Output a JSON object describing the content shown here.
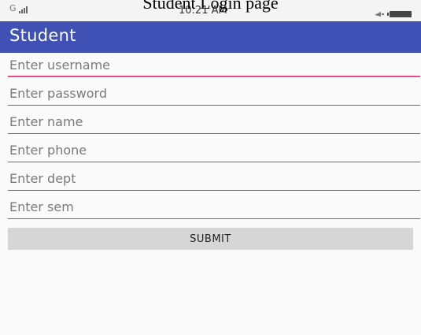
{
  "caption": "Student Login page",
  "status_bar": {
    "network": "G",
    "time": "10:21 AM",
    "icons": [
      "signal-icon",
      "notification-icon",
      "battery-icon"
    ]
  },
  "toolbar": {
    "title": "Student",
    "color": "#3f51b5"
  },
  "form": {
    "fields": [
      {
        "placeholder": "Enter username",
        "value": ""
      },
      {
        "placeholder": "Enter password",
        "value": ""
      },
      {
        "placeholder": "Enter name",
        "value": ""
      },
      {
        "placeholder": "Enter phone",
        "value": ""
      },
      {
        "placeholder": "Enter dept",
        "value": ""
      },
      {
        "placeholder": "Enter sem",
        "value": ""
      }
    ],
    "focus_color": "#e64a8c",
    "submit_label": "SUBMIT"
  }
}
